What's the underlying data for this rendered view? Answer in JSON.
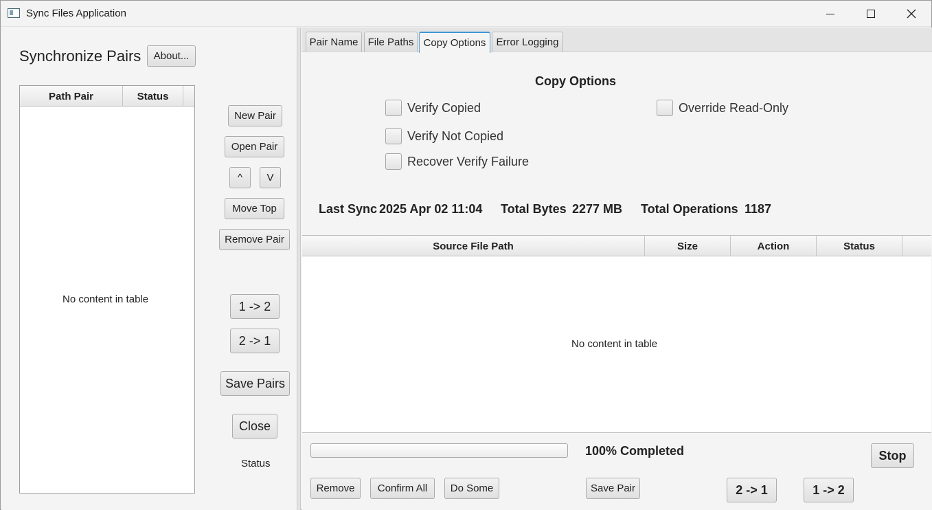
{
  "window": {
    "title": "Sync Files Application"
  },
  "left": {
    "heading": "Synchronize Pairs",
    "about_label": "About...",
    "table": {
      "columns": [
        "Path Pair",
        "Status"
      ],
      "empty_text": "No content in table"
    },
    "buttons": {
      "new_pair": "New Pair",
      "open_pair": "Open Pair",
      "up": "^",
      "down": "V",
      "move_top": "Move Top",
      "remove_pair": "Remove Pair",
      "one_to_two": "1 -> 2",
      "two_to_one": "2 -> 1",
      "save_pairs": "Save Pairs",
      "close": "Close"
    },
    "status_label": "Status"
  },
  "right": {
    "tabs": [
      {
        "label": "Pair Name",
        "active": false
      },
      {
        "label": "File Paths",
        "active": false
      },
      {
        "label": "Copy Options",
        "active": true
      },
      {
        "label": "Error Logging",
        "active": false
      }
    ],
    "copy_options": {
      "title": "Copy Options",
      "verify_copied": {
        "label": "Verify Copied",
        "checked": false
      },
      "override_read_only": {
        "label": "Override Read-Only",
        "checked": false
      },
      "verify_not_copied": {
        "label": "Verify Not Copied",
        "checked": false
      },
      "recover_verify_failure": {
        "label": "Recover Verify Failure",
        "checked": false
      }
    },
    "stats": {
      "last_sync_label": "Last Sync",
      "last_sync_value": "2025 Apr 02 11:04",
      "total_bytes_label": "Total Bytes",
      "total_bytes_value": "2277 MB",
      "total_ops_label": "Total Operations",
      "total_ops_value": "1187"
    },
    "files_table": {
      "columns": [
        "Source File Path",
        "Size",
        "Action",
        "Status"
      ],
      "empty_text": "No content in table"
    },
    "progress": {
      "fraction": 0.0,
      "label": "100% Completed"
    },
    "buttons": {
      "stop": "Stop",
      "remove": "Remove",
      "confirm_all": "Confirm All",
      "do_some": "Do Some",
      "save_pair": "Save Pair",
      "two_to_one": "2 -> 1",
      "one_to_two": "1 -> 2"
    }
  }
}
